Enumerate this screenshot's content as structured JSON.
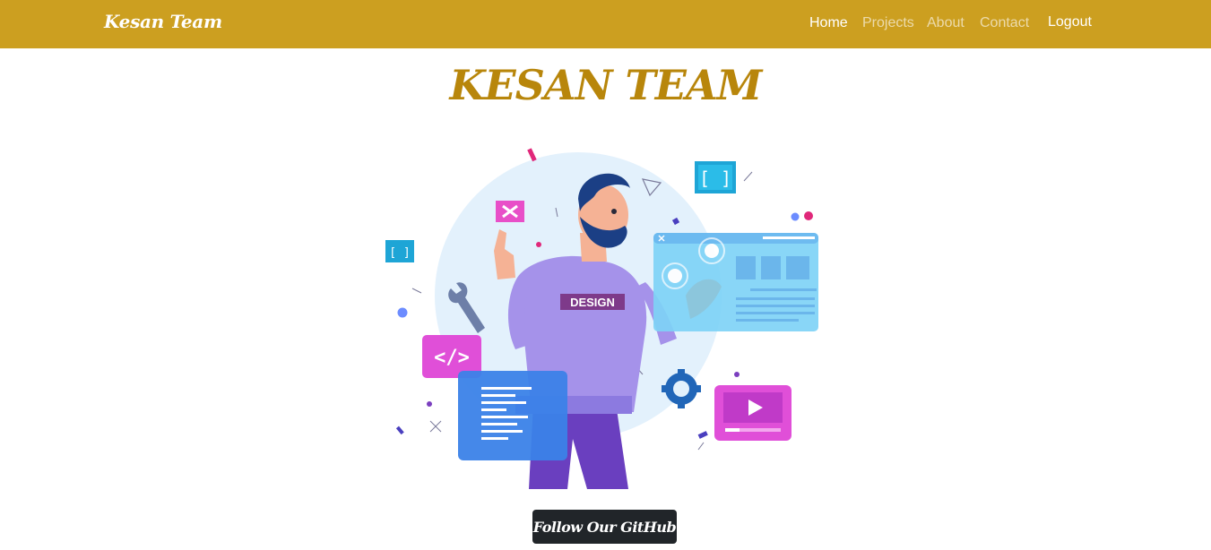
{
  "navbar": {
    "brand": "Kesan Team",
    "links": [
      {
        "label": "Home",
        "state": "active"
      },
      {
        "label": "Projects",
        "state": "muted"
      },
      {
        "label": "About",
        "state": "muted"
      },
      {
        "label": "Contact",
        "state": "muted"
      }
    ],
    "logout_label": "Logout"
  },
  "hero": {
    "title": "KESAN TEAM",
    "illustration": {
      "badge_text": "DESIGN",
      "icons": [
        "close-icon",
        "code-icon",
        "wrench-icon",
        "gear-icon",
        "play-icon",
        "bracket-icon"
      ]
    },
    "button_label": "Follow Our GitHub"
  },
  "colors": {
    "navbar_bg": "#cc9f20",
    "title": "#b8860b",
    "button_bg": "#212529"
  }
}
